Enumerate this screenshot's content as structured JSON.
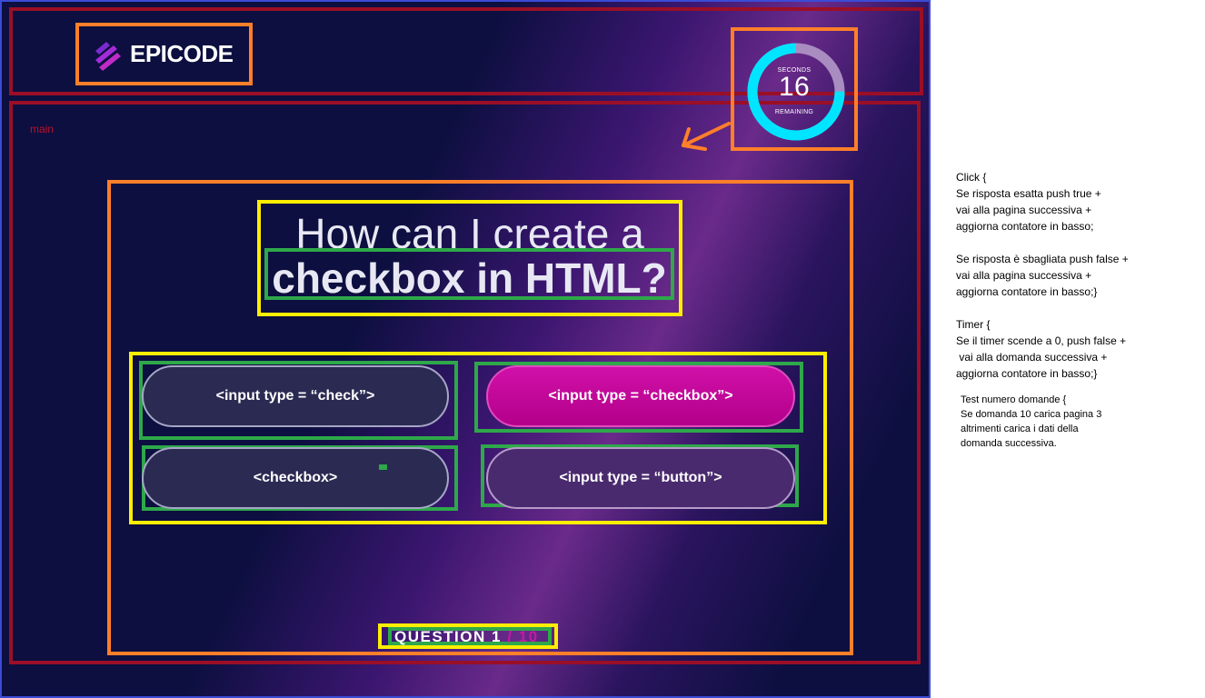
{
  "logo": {
    "text": "EPICODE"
  },
  "header_label": "main",
  "timer": {
    "top_label": "SECONDS",
    "value": "16",
    "bottom_label": "REMAINING",
    "fraction_remaining": 0.75
  },
  "question": {
    "line1": "How can I create a",
    "line2": "checkbox in HTML?"
  },
  "answers": [
    {
      "label": "<input type = “check”>"
    },
    {
      "label": "<input type = “checkbox”>"
    },
    {
      "label": "<checkbox>"
    },
    {
      "label": "<input type = “button”>"
    }
  ],
  "counter": {
    "label": "QUESTION 1",
    "total": "/ 10"
  },
  "notes": [
    "Click {\nSe risposta esatta push true +\nvai alla pagina successiva +\naggiorna contatore in basso;",
    "Se risposta è sbagliata push false +\nvai alla pagina successiva +\naggiorna contatore in basso;}",
    "Timer {\nSe il timer scende a 0, push false +\n vai alla domanda successiva +\naggiorna contatore in basso;}",
    "Test numero domande {\nSe domanda 10 carica pagina 3\naltrimenti carica i dati della\ndomanda successiva."
  ],
  "colors": {
    "accent": "#d010a8",
    "timer_ring": "#00e5ff",
    "background": "#0c0f3f"
  }
}
